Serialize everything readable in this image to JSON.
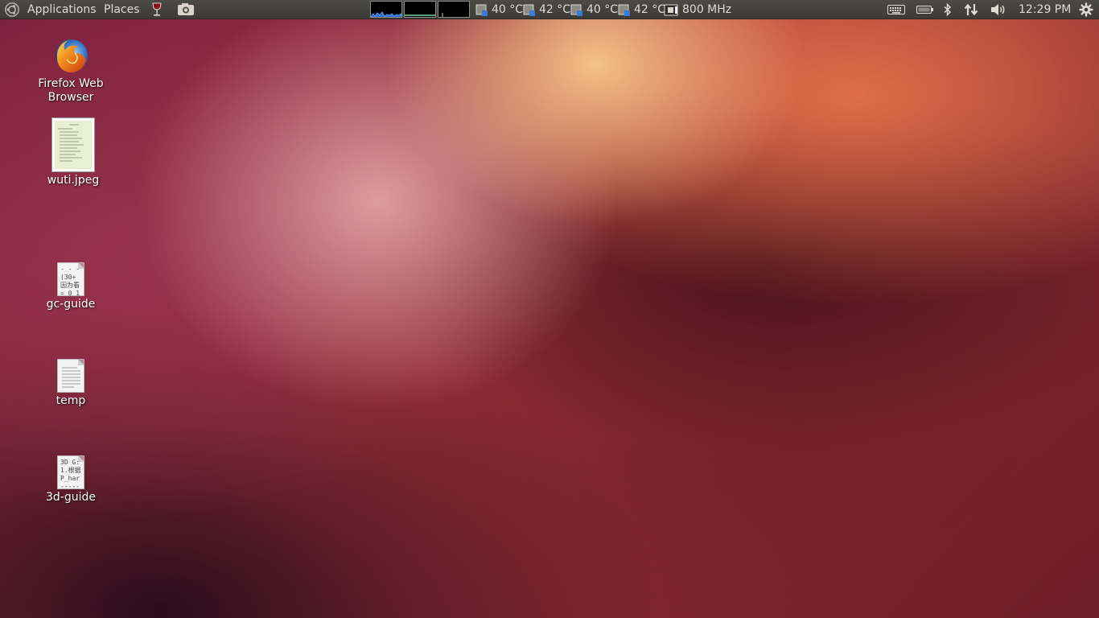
{
  "panel": {
    "menus": {
      "applications": "Applications",
      "places": "Places"
    },
    "sensors": [
      {
        "label": "40 °C"
      },
      {
        "label": "42 °C"
      },
      {
        "label": "40 °C"
      },
      {
        "label": "42 °C"
      }
    ],
    "cpu_freq": "800 MHz",
    "clock": "12:29 PM",
    "icons": {
      "launcher": "ubuntu-logo-icon",
      "wine": "wine-glass-icon",
      "screenshot": "camera-icon",
      "keyboard": "keyboard-icon",
      "battery": "battery-icon",
      "bluetooth": "bluetooth-icon",
      "network": "network-arrows-icon",
      "volume": "volume-icon",
      "session": "gear-icon"
    }
  },
  "desktop": {
    "items": [
      {
        "label": "Firefox Web Browser",
        "icon": "firefox-icon"
      },
      {
        "label": "wuti.jpeg",
        "icon": "image-thumbnail-icon"
      },
      {
        "label": "gc-guide",
        "icon": "text-document-icon",
        "preview": "- - - -\n(30+\n因为看\n= 0 1 ,"
      },
      {
        "label": "temp",
        "icon": "text-document-icon"
      },
      {
        "label": "3d-guide",
        "icon": "text-document-icon",
        "preview": "3D G:\n1.根据\nP_har\n-----"
      }
    ]
  },
  "colors": {
    "panel_bg": "#3c3b37",
    "panel_text": "#dfdbd2",
    "desktop_accent": "#e8764a"
  }
}
